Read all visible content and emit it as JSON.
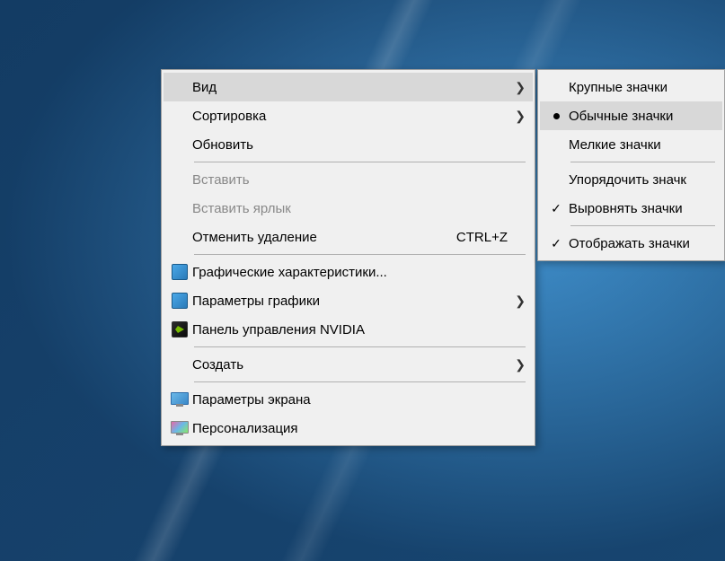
{
  "main_menu": {
    "view": {
      "label": "Вид",
      "has_submenu": true,
      "highlighted": true
    },
    "sort": {
      "label": "Сортировка",
      "has_submenu": true
    },
    "refresh": {
      "label": "Обновить"
    },
    "paste": {
      "label": "Вставить",
      "disabled": true
    },
    "paste_shortcut": {
      "label": "Вставить ярлык",
      "disabled": true
    },
    "undo_delete": {
      "label": "Отменить удаление",
      "shortcut": "CTRL+Z"
    },
    "graphics_props": {
      "label": "Графические характеристики..."
    },
    "graphics_params": {
      "label": "Параметры графики",
      "has_submenu": true
    },
    "nvidia_panel": {
      "label": "Панель управления NVIDIA"
    },
    "create": {
      "label": "Создать",
      "has_submenu": true
    },
    "display_settings": {
      "label": "Параметры экрана"
    },
    "personalize": {
      "label": "Персонализация"
    }
  },
  "view_submenu": {
    "large_icons": {
      "label": "Крупные значки"
    },
    "medium_icons": {
      "label": "Обычные значки",
      "selected": true,
      "highlighted": true
    },
    "small_icons": {
      "label": "Мелкие значки"
    },
    "auto_arrange": {
      "label": "Упорядочить значк"
    },
    "align_grid": {
      "label": "Выровнять значки",
      "checked": true
    },
    "show_icons": {
      "label": "Отображать значки",
      "checked": true
    }
  }
}
